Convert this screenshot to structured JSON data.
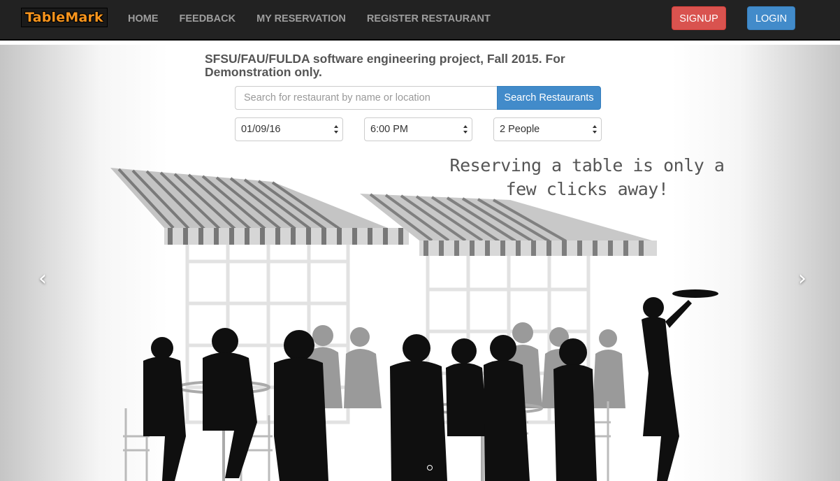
{
  "nav": {
    "brand": "TableMark",
    "links": [
      "HOME",
      "FEEDBACK",
      "MY RESERVATION",
      "REGISTER RESTAURANT"
    ],
    "signup": "SIGNUP",
    "login": "LOGIN"
  },
  "colors": {
    "navbar": "#222222",
    "brand_orange": "#f7941d",
    "signup": "#d9534f",
    "primary": "#428bca"
  },
  "search": {
    "note": "SFSU/FAU/FULDA software engineering project, Fall 2015. For Demonstration only.",
    "placeholder": "Search for restaurant by name or location",
    "value": "",
    "button": "Search Restaurants",
    "date": "01/09/16",
    "time": "6:00 PM",
    "party": "2 People"
  },
  "carousel": {
    "tagline_line1": "Reserving a table is only a",
    "tagline_line2": "few clicks away!",
    "icons": {
      "prev": "chevron-left-icon",
      "next": "chevron-right-icon"
    },
    "slide_index": 1,
    "slide_count": 1
  }
}
